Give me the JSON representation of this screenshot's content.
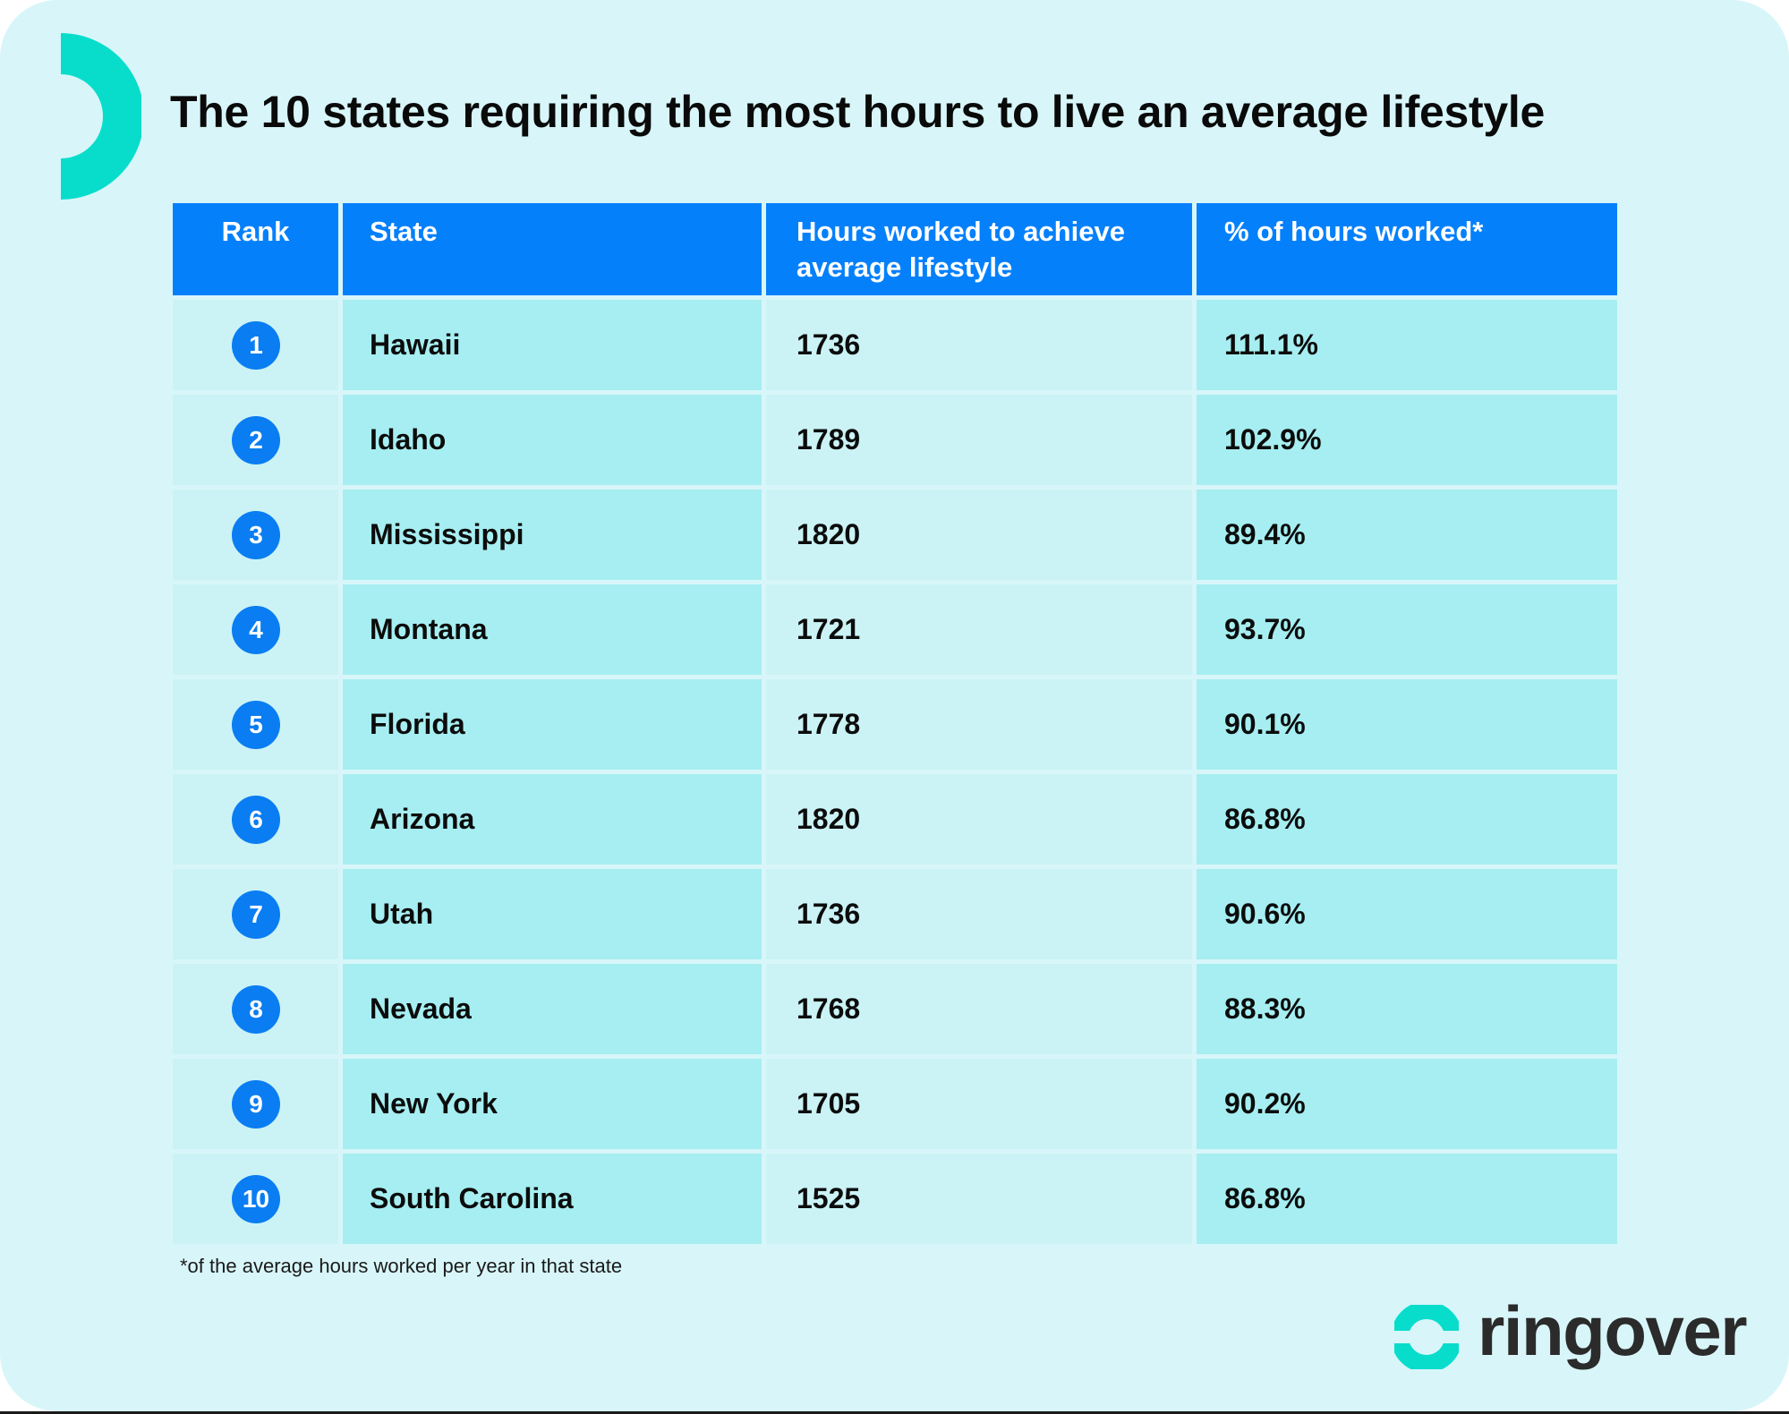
{
  "title": {
    "prefix": "The 10 states requiring the ",
    "emphasis": "most",
    "suffix": " hours to live an average lifestyle"
  },
  "colors": {
    "background": "#D8F6F9",
    "header": "#0580FB",
    "rank_badge": "#0A7DF2",
    "cell_light": "#CBF3F6",
    "cell_dark": "#A6EEF1",
    "accent_teal": "#08DDCC"
  },
  "table": {
    "headers": {
      "rank": "Rank",
      "state": "State",
      "hours": "Hours worked to achieve average lifestyle",
      "pct": "% of hours worked*"
    },
    "rows": [
      {
        "rank": "1",
        "state": "Hawaii",
        "hours": "1736",
        "pct": "111.1%"
      },
      {
        "rank": "2",
        "state": "Idaho",
        "hours": "1789",
        "pct": "102.9%"
      },
      {
        "rank": "3",
        "state": "Mississippi",
        "hours": "1820",
        "pct": "89.4%"
      },
      {
        "rank": "4",
        "state": "Montana",
        "hours": "1721",
        "pct": "93.7%"
      },
      {
        "rank": "5",
        "state": "Florida",
        "hours": "1778",
        "pct": "90.1%"
      },
      {
        "rank": "6",
        "state": "Arizona",
        "hours": "1820",
        "pct": "86.8%"
      },
      {
        "rank": "7",
        "state": "Utah",
        "hours": "1736",
        "pct": "90.6%"
      },
      {
        "rank": "8",
        "state": "Nevada",
        "hours": "1768",
        "pct": "88.3%"
      },
      {
        "rank": "9",
        "state": "New York",
        "hours": "1705",
        "pct": "90.2%"
      },
      {
        "rank": "10",
        "state": "South Carolina",
        "hours": "1525",
        "pct": "86.8%"
      }
    ]
  },
  "footnote": "*of the average hours worked per year in that state",
  "brand": {
    "name": "ringover",
    "icon": "ringover-ring-logo-icon",
    "decoration_icon": "teal-half-ring-icon"
  },
  "chart_data": {
    "type": "table",
    "title": "The 10 states requiring the most hours to live an average lifestyle",
    "columns": [
      "Rank",
      "State",
      "Hours worked to achieve average lifestyle",
      "% of hours worked*"
    ],
    "rows": [
      [
        1,
        "Hawaii",
        1736,
        111.1
      ],
      [
        2,
        "Idaho",
        1789,
        102.9
      ],
      [
        3,
        "Mississippi",
        1820,
        89.4
      ],
      [
        4,
        "Montana",
        1721,
        93.7
      ],
      [
        5,
        "Florida",
        1778,
        90.1
      ],
      [
        6,
        "Arizona",
        1820,
        86.8
      ],
      [
        7,
        "Utah",
        1736,
        90.6
      ],
      [
        8,
        "Nevada",
        1768,
        88.3
      ],
      [
        9,
        "New York",
        1705,
        90.2
      ],
      [
        10,
        "South Carolina",
        1525,
        86.8
      ]
    ],
    "footnote": "*of the average hours worked per year in that state"
  }
}
